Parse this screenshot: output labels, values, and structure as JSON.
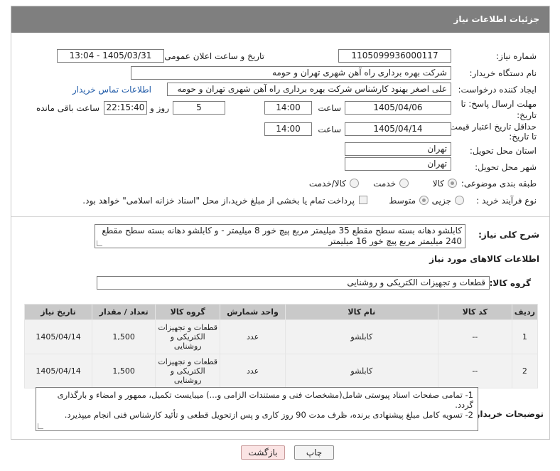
{
  "header": {
    "title": "جزئیات اطلاعات نیاز"
  },
  "fields": {
    "need_number_label": "شماره نیاز:",
    "need_number": "1105099936000117",
    "announce_label": "تاریخ و ساعت اعلان عمومی:",
    "announce_value": "1405/03/31 - 13:04",
    "buyer_org_label": "نام دستگاه خریدار:",
    "buyer_org": "شرکت بهره برداری راه آهن شهری تهران و حومه",
    "requester_label": "ایجاد کننده درخواست:",
    "requester": "علی اصغر بهنود کارشناس شرکت بهره برداری راه آهن شهری تهران و حومه",
    "contact_link": "اطلاعات تماس خریدار",
    "deadline_label_1": "مهلت ارسال پاسخ: تا",
    "deadline_label_2": "تاریخ:",
    "deadline_date": "1405/04/06",
    "time_label": "ساعت",
    "deadline_time": "14:00",
    "days_value": "5",
    "days_label": "روز و",
    "remaining_time": "22:15:40",
    "remaining_label": "ساعت باقی مانده",
    "price_validity_label_1": "حداقل تاریخ اعتبار قیمت:",
    "price_validity_label_2": "تا تاریخ:",
    "price_validity_date": "1405/04/14",
    "price_validity_time": "14:00",
    "province_label": "استان محل تحویل:",
    "province": "تهران",
    "city_label": "شهر محل تحویل:",
    "city": "تهران",
    "category_label": "طبقه بندی موضوعی:",
    "category_options": [
      "کالا",
      "خدمت",
      "کالا/خدمت"
    ],
    "category_selected": "کالا",
    "process_label": "نوع فرآیند خرید :",
    "process_options": [
      "جزیی",
      "متوسط"
    ],
    "process_selected": "متوسط",
    "payment_note": "پرداخت تمام یا بخشی از مبلغ خرید،از محل \"اسناد خزانه اسلامی\" خواهد بود."
  },
  "description": {
    "label": "شرح کلی نیاز:",
    "text": "کابلشو دهانه بسته سطح مقطع 35 میلیمتر مربع پیچ خور 8 میلیمتر - و کابلشو دهانه بسته سطح مقطع 240 میلیمتر مربع پیچ خور 16 میلیمتر"
  },
  "goods_info": {
    "title": "اطلاعات کالاهای مورد نیاز",
    "group_label": "گروه کالا:",
    "group_value": "قطعات و تجهیزات الکتریکی و روشنایی"
  },
  "table": {
    "headers": [
      "ردیف",
      "کد کالا",
      "نام کالا",
      "واحد شمارش",
      "گروه کالا",
      "تعداد / مقدار",
      "تاریخ نیاز"
    ],
    "rows": [
      [
        "1",
        "--",
        "کابلشو",
        "عدد",
        "قطعات و تجهیزات الکتریکی و روشنایی",
        "1,500",
        "1405/04/14"
      ],
      [
        "2",
        "--",
        "کابلشو",
        "عدد",
        "قطعات و تجهیزات الکتریکی و روشنایی",
        "1,500",
        "1405/04/14"
      ]
    ]
  },
  "buyer_notes": {
    "label": "توضیحات خریدار:",
    "line1": "1- تمامی صفحات اسناد پیوستی شامل(مشخصات فنی و مستندات الزامی و...) میبایست تکمیل، ممهور و امضاء و بارگذاری گردد.",
    "line2": "2- تسویه کامل مبلغ پیشنهادی برنده، ظرف مدت 90 روز کاری و پس ازتحویل قطعی و تأئید کارشناس فنی انجام میپذیرد."
  },
  "buttons": {
    "print": "چاپ",
    "back": "بازگشت"
  }
}
